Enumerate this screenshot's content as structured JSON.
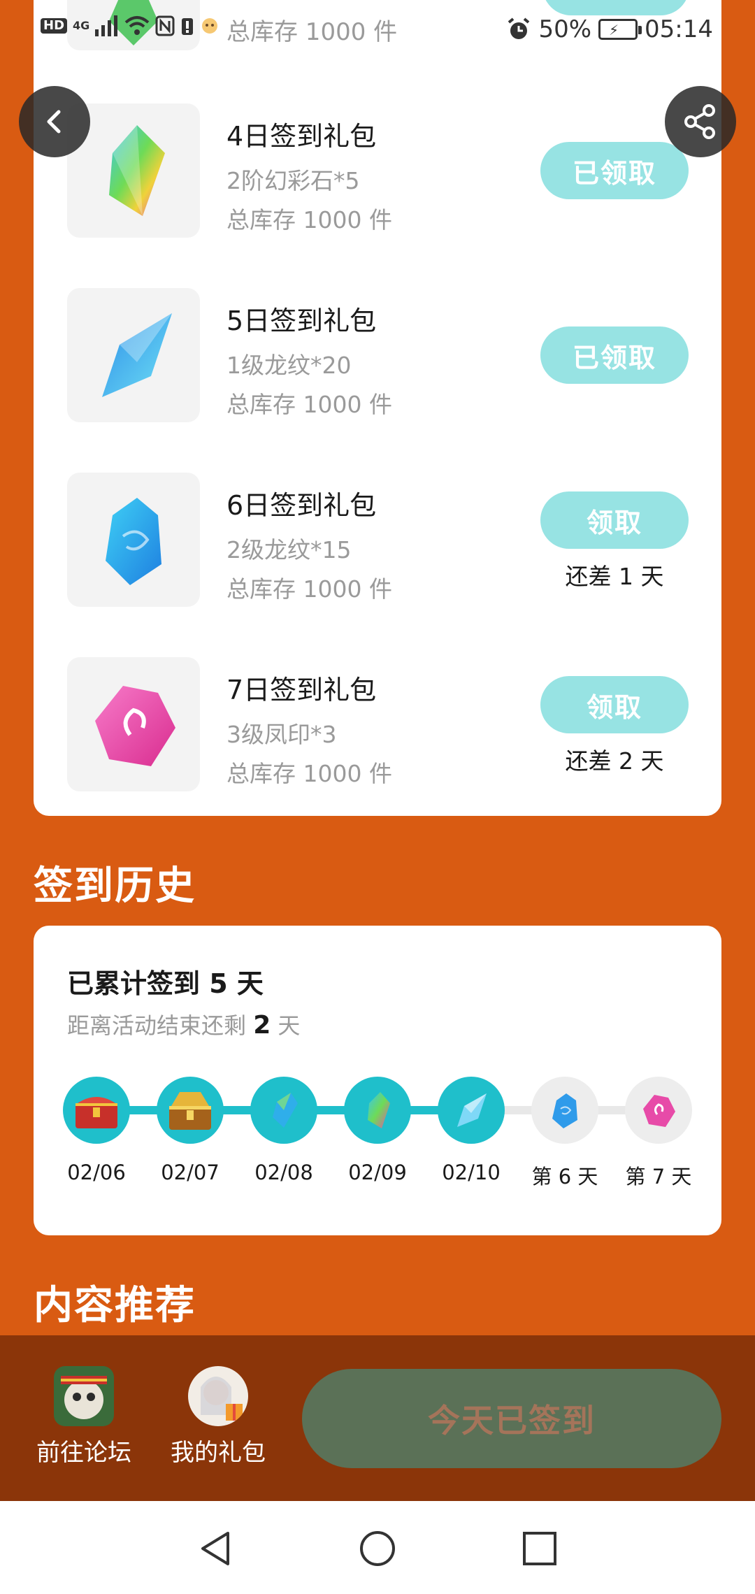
{
  "status_bar": {
    "left_badges": [
      "HD",
      "4G"
    ],
    "battery_percent": "50%",
    "time": "05:14"
  },
  "partial_item": {
    "stock": "总库存 1000 件"
  },
  "gifts": [
    {
      "title": "4日签到礼包",
      "desc": "2阶幻彩石*5",
      "stock": "总库存 1000 件",
      "button": "已领取",
      "note": "",
      "icon": "rainbow-crystal-icon"
    },
    {
      "title": "5日签到礼包",
      "desc": "1级龙纹*20",
      "stock": "总库存 1000 件",
      "button": "已领取",
      "note": "",
      "icon": "blue-dragon-shard-icon"
    },
    {
      "title": "6日签到礼包",
      "desc": "2级龙纹*15",
      "stock": "总库存 1000 件",
      "button": "领取",
      "note": "还差 1 天",
      "icon": "blue-dragon-gem-icon"
    },
    {
      "title": "7日签到礼包",
      "desc": "3级凤印*3",
      "stock": "总库存 1000 件",
      "button": "领取",
      "note": "还差 2 天",
      "icon": "pink-phoenix-gem-icon"
    }
  ],
  "history": {
    "section_title": "签到历史",
    "total_prefix": "已累计签到 ",
    "total_days": "5",
    "total_suffix": " 天",
    "remaining_prefix": "距离活动结束还剩 ",
    "remaining_days": "2",
    "remaining_suffix": " 天",
    "days": [
      {
        "label": "02/06",
        "done": true,
        "icon": "red-chest-icon"
      },
      {
        "label": "02/07",
        "done": true,
        "icon": "gold-chest-icon"
      },
      {
        "label": "02/08",
        "done": true,
        "icon": "green-crystal-icon"
      },
      {
        "label": "02/09",
        "done": true,
        "icon": "rainbow-crystal-icon"
      },
      {
        "label": "02/10",
        "done": true,
        "icon": "blue-dragon-shard-icon"
      },
      {
        "label": "第 6 天",
        "done": false,
        "icon": "blue-dragon-gem-icon"
      },
      {
        "label": "第 7 天",
        "done": false,
        "icon": "pink-phoenix-gem-icon"
      }
    ]
  },
  "recommend": {
    "section_title": "内容推荐"
  },
  "bottom_bar": {
    "forum_label": "前往论坛",
    "gifts_label": "我的礼包",
    "checkin_label": "今天已签到"
  },
  "colors": {
    "page_bg": "#D95B12",
    "bottom_bar_bg": "#8B3509",
    "teal": "#1FBFCB",
    "claim_button": "#97E3E3",
    "checkin_button": "#5B7157"
  }
}
